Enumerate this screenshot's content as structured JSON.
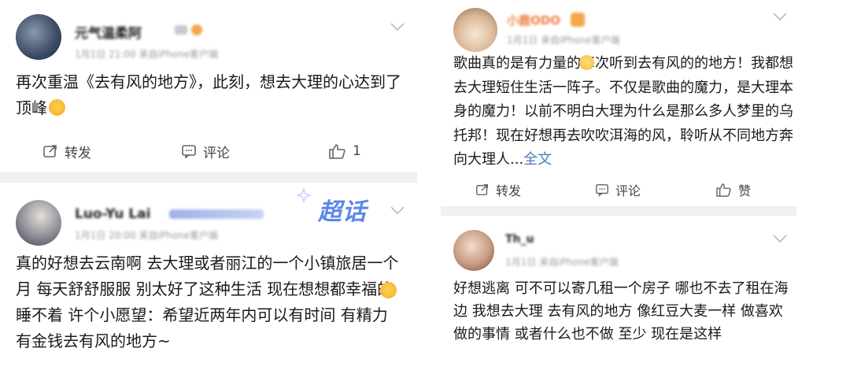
{
  "posts": [
    {
      "name": "元气温柔阿",
      "meta": "1月1日 21:00 来自iPhone客户端",
      "text": "再次重温《去有风的地方》，此刻，想去大理的心达到了顶峰",
      "actions": {
        "repost": "转发",
        "comment": "评论",
        "like_count": "1"
      }
    },
    {
      "name": "Luo-Yu Lai",
      "meta": "1月1日 20:00 来自iPhone客户端",
      "badge": "超话",
      "text": "真的好想去云南啊 去大理或者丽江的一个小镇旅居一个月 每天舒舒服服 别太好了这种生活 现在想想都幸福的睡不着 许个小愿望：希望近两年内可以有时间 有精力 有金钱去有风的地方~"
    },
    {
      "name": "小鹿ODO",
      "meta": "1月1日 来自iPhone客户端",
      "text": "歌曲真的是有力量的每次听到去有风的的地方！我都想去大理短住生活一阵子。不仅是歌曲的魔力，是大理本身的魔力！以前不明白大理为什么是那么多人梦里的乌托邦！现在好想再去吹吹洱海的风，聆听从不同地方奔向大理人...",
      "more": "全文",
      "actions": {
        "repost": "转发",
        "comment": "评论",
        "like": "赞"
      }
    },
    {
      "name": "Th_u",
      "meta": "1月1日 来自iPhone客户端",
      "text": "好想逃离 可不可以寄几租一个房子 哪也不去了租在海边 我想去大理 去有风的地方 像红豆大麦一样 做喜欢做的事情 或者什么也不做 至少 现在是这样"
    }
  ]
}
